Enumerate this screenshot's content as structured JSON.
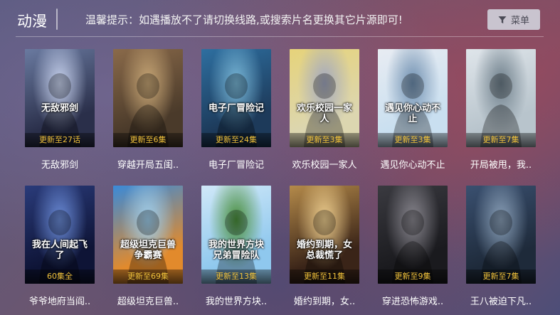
{
  "header": {
    "title": "动漫",
    "tip": "温馨提示：如遇播放不了请切换线路,或搜索片名更换其它片源即可!",
    "menu_label": "菜单"
  },
  "items": [
    {
      "title": "无敌邪剑",
      "episode": "更新至27话",
      "poster_text": "无敌邪剑",
      "colors": [
        "#2a2f4a",
        "#6a7aa0",
        "#c9d4f0"
      ]
    },
    {
      "title": "穿越开局五闺..",
      "episode": "更新至6集",
      "poster_text": "",
      "colors": [
        "#4a3a2a",
        "#8a6a4a",
        "#c9a877"
      ]
    },
    {
      "title": "电子厂冒险记",
      "episode": "更新至24集",
      "poster_text": "电子厂冒险记",
      "colors": [
        "#1d3a5a",
        "#2e6fa0",
        "#7ab8d8"
      ]
    },
    {
      "title": "欢乐校园一家人",
      "episode": "更新至3集",
      "poster_text": "欢乐校园一家人",
      "colors": [
        "#dcd6b0",
        "#e6d37a",
        "#a2a8c0"
      ]
    },
    {
      "title": "遇见你心动不止",
      "episode": "更新至3集",
      "poster_text": "遇见你心动不止",
      "colors": [
        "#c9dff0",
        "#e8ecf2",
        "#6f8fb0"
      ]
    },
    {
      "title": "开局被甩，我..",
      "episode": "更新至7集",
      "poster_text": "",
      "colors": [
        "#b8c4cc",
        "#dfe5ea",
        "#6d7e8a"
      ]
    },
    {
      "title": "爷爷地府当阎..",
      "episode": "60集全",
      "poster_text": "我在人间起飞了",
      "colors": [
        "#0e1436",
        "#2a3b7a",
        "#6b8cd8"
      ]
    },
    {
      "title": "超级坦克巨兽..",
      "episode": "更新至69集",
      "poster_text": "超级坦克巨兽争霸赛",
      "colors": [
        "#e28a2c",
        "#3a8ad8",
        "#a0d0ee"
      ]
    },
    {
      "title": "我的世界方块..",
      "episode": "更新至13集",
      "poster_text": "我的世界方块兄弟冒险队",
      "colors": [
        "#8fc8ee",
        "#d0e8f8",
        "#4a8f3a"
      ]
    },
    {
      "title": "婚约到期，女..",
      "episode": "更新至11集",
      "poster_text": "婚约到期，女总裁慌了",
      "colors": [
        "#3a2418",
        "#b48a4a",
        "#f0d090"
      ]
    },
    {
      "title": "穿进恐怖游戏..",
      "episode": "更新至9集",
      "poster_text": "",
      "colors": [
        "#1a1a1e",
        "#3a3a40",
        "#8a8890"
      ]
    },
    {
      "title": "王八被迫下凡..",
      "episode": "更新至7集",
      "poster_text": "",
      "colors": [
        "#1e2a3a",
        "#3a5070",
        "#8aa0b8"
      ]
    }
  ]
}
